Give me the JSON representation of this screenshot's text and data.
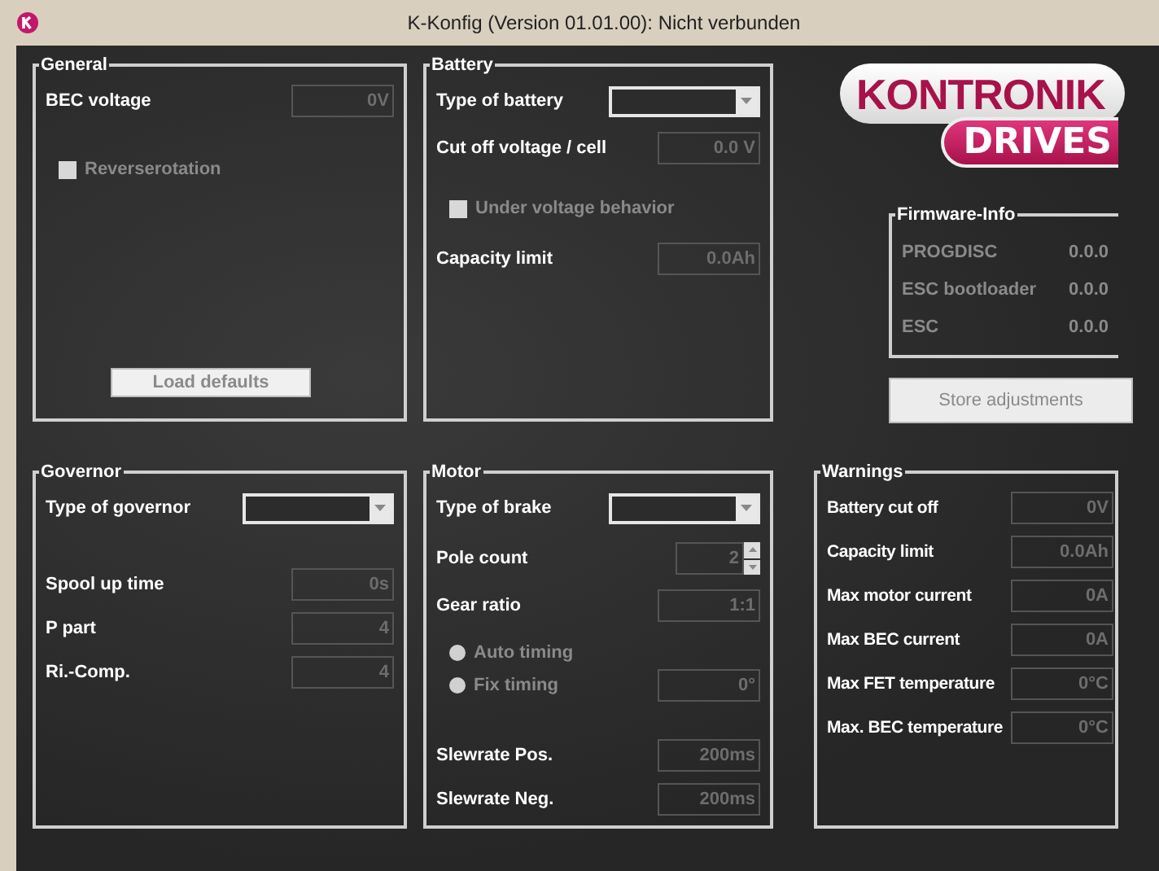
{
  "window": {
    "title": "K-Konfig (Version 01.01.00): Nicht verbunden"
  },
  "general": {
    "title": "General",
    "rows": [
      {
        "kind": "field",
        "label": "BEC voltage",
        "value": "0V",
        "disabled": true
      },
      {
        "kind": "checkbox",
        "label": "Reverserotation",
        "checked": false,
        "disabled": true
      },
      {
        "kind": "button",
        "label": "Load defaults",
        "disabled": true
      }
    ]
  },
  "battery": {
    "title": "Battery",
    "rows": [
      {
        "kind": "combo",
        "label": "Type of battery"
      },
      {
        "kind": "field",
        "label": "Cut off voltage / cell",
        "value": "0.0 V",
        "disabled": true
      },
      {
        "kind": "checkbox",
        "label": "Under voltage behavior",
        "checked": false,
        "disabled": true
      },
      {
        "kind": "field",
        "label": "Capacity limit",
        "value": "0.0Ah",
        "disabled": true
      }
    ]
  },
  "logo": {
    "name": "KONTRONIK",
    "tag": "DRIVES"
  },
  "firmware": {
    "title": "Firmware-Info",
    "rows": [
      {
        "kind": "info",
        "label": "PROGDISC",
        "value": "0.0.0"
      },
      {
        "kind": "info",
        "label": "ESC bootloader",
        "value": "0.0.0"
      },
      {
        "kind": "info",
        "label": "ESC",
        "value": "0.0.0"
      }
    ]
  },
  "store_button": {
    "label": "Store adjustments",
    "disabled": true
  },
  "governor": {
    "title": "Governor",
    "rows": [
      {
        "kind": "combo",
        "label": "Type of governor"
      },
      {
        "kind": "field",
        "label": "Spool up time",
        "value": "0s",
        "disabled": true
      },
      {
        "kind": "field",
        "label": "P part",
        "value": "4",
        "disabled": true
      },
      {
        "kind": "field",
        "label": "Ri.-Comp.",
        "value": "4",
        "disabled": true
      }
    ]
  },
  "motor": {
    "title": "Motor",
    "rows": [
      {
        "kind": "combo",
        "label": "Type of brake"
      },
      {
        "kind": "spin",
        "label": "Pole count",
        "value": "2",
        "disabled": true
      },
      {
        "kind": "field",
        "label": "Gear ratio",
        "value": "1:1",
        "disabled": true
      },
      {
        "kind": "radio",
        "label": "Auto timing",
        "selected": false,
        "disabled": true
      },
      {
        "kind": "radio",
        "label": "Fix timing",
        "selected": false,
        "disabled": true,
        "value": "0°"
      },
      {
        "kind": "field",
        "label": "Slewrate Pos.",
        "value": "200ms",
        "disabled": true
      },
      {
        "kind": "field",
        "label": "Slewrate Neg.",
        "value": "200ms",
        "disabled": true
      }
    ]
  },
  "warnings": {
    "title": "Warnings",
    "rows": [
      {
        "kind": "field",
        "label": "Battery cut off",
        "value": "0V",
        "disabled": true
      },
      {
        "kind": "field",
        "label": "Capacity limit",
        "value": "0.0Ah",
        "disabled": true
      },
      {
        "kind": "field",
        "label": "Max motor current",
        "value": "0A",
        "disabled": true
      },
      {
        "kind": "field",
        "label": "Max BEC current",
        "value": "0A",
        "disabled": true
      },
      {
        "kind": "field",
        "label": "Max FET temperature",
        "value": "0°C",
        "disabled": true
      },
      {
        "kind": "field",
        "label": "Max. BEC temperature",
        "value": "0°C",
        "disabled": true
      }
    ]
  }
}
